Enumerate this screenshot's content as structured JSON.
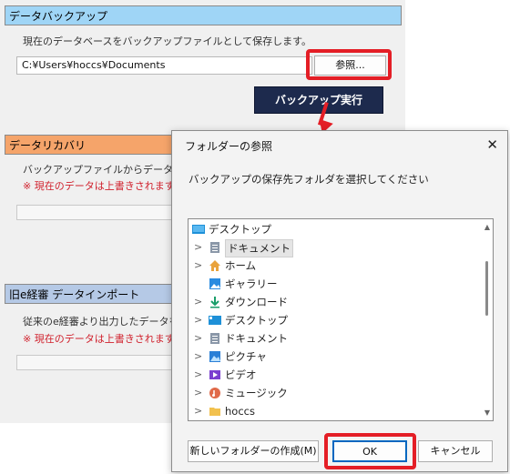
{
  "backup": {
    "title": "データバックアップ",
    "description": "現在のデータベースをバックアップファイルとして保存します。",
    "path": "C:¥Users¥hoccs¥Documents",
    "browse_label": "参照...",
    "execute_label": "バックアップ実行"
  },
  "recovery": {
    "title": "データリカバリ",
    "description": "バックアップファイルからデータを復元",
    "warning": "※ 現在のデータは上書きされます。"
  },
  "import": {
    "title": "旧e経審 データインポート",
    "description": "従来のe経審より出力したデータを",
    "warning": "※ 現在のデータは上書きされます。"
  },
  "dialog": {
    "title": "フォルダーの参照",
    "close_label": "✕",
    "message": "バックアップの保存先フォルダを選択してください",
    "root_label": "デスクトップ",
    "items": [
      {
        "label": "ドキュメント",
        "icon": "document-icon",
        "selected": true
      },
      {
        "label": "ホーム",
        "icon": "home-icon"
      },
      {
        "label": "ギャラリー",
        "icon": "gallery-icon"
      },
      {
        "label": "ダウンロード",
        "icon": "download-icon"
      },
      {
        "label": "デスクトップ",
        "icon": "desktop-icon"
      },
      {
        "label": "ドキュメント",
        "icon": "document-icon"
      },
      {
        "label": "ピクチャ",
        "icon": "pictures-icon"
      },
      {
        "label": "ビデオ",
        "icon": "video-icon"
      },
      {
        "label": "ミュージック",
        "icon": "music-icon"
      },
      {
        "label": "hoccs",
        "icon": "folder-icon"
      }
    ],
    "new_folder_label": "新しいフォルダーの作成(M)",
    "ok_label": "OK",
    "cancel_label": "キャンセル"
  },
  "colors": {
    "backup_header": "#9fd5f6",
    "recovery_header": "#f5a46a",
    "import_header": "#b5c9e6",
    "highlight": "#e41e26",
    "execute_button": "#1d2a4d"
  }
}
